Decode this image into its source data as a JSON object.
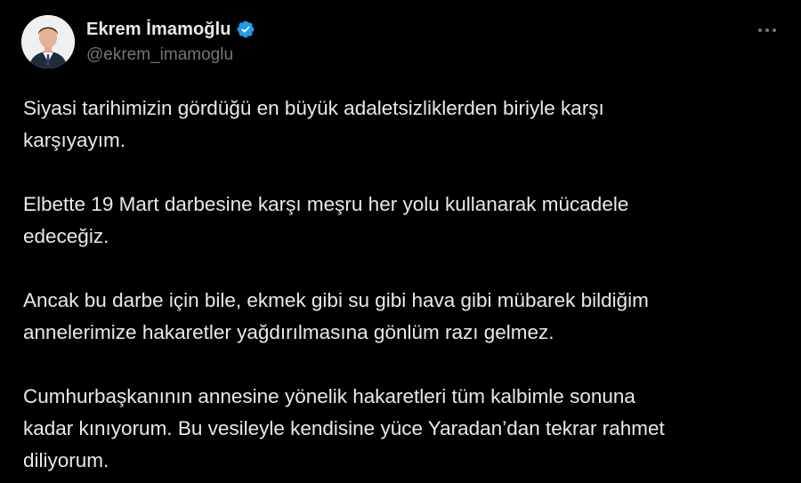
{
  "author": {
    "display_name": "Ekrem İmamoğlu",
    "handle": "@ekrem_imamoglu",
    "verified": true,
    "verified_color": "#1d9bf0"
  },
  "actions": {
    "more_icon": "more-dots-icon"
  },
  "tweet": {
    "paragraphs": [
      "Siyasi tarihimizin gördüğü en büyük adaletsizliklerden biriyle karşı\nkarşıyayım.",
      "Elbette 19 Mart darbesine karşı meşru her yolu kullanarak mücadele\nedeceğiz.",
      "Ancak bu darbe için bile, ekmek gibi su gibi hava gibi mübarek bildiğim\nannelerimize hakaretler yağdırılmasına gönlüm razı gelmez.",
      "Cumhurbaşkanının annesine yönelik hakaretleri tüm kalbimle sonuna\nkadar kınıyorum. Bu vesileyle kendisine yüce Yaradan’dan tekrar rahmet\ndiliyorum."
    ]
  },
  "colors": {
    "background": "#000000",
    "text": "#e7e9ea",
    "secondary_text": "#71767b"
  }
}
